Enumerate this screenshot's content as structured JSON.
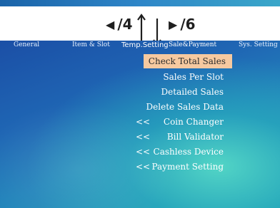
{
  "hints": {
    "left_label": "/4",
    "right_label": "/6",
    "left_icon": "triangle-left-icon",
    "right_icon": "triangle-right-icon",
    "updown_icon": "up-down-arrows-icon"
  },
  "tabs": [
    {
      "label": "General"
    },
    {
      "label": "Item & Slot"
    },
    {
      "label": "Temp.Setting"
    },
    {
      "label": "Sale&Payment",
      "active": true
    },
    {
      "label": "Sys. Setting"
    }
  ],
  "menu": {
    "items": [
      {
        "label": "Check Total Sales",
        "selected": true,
        "prefix": ""
      },
      {
        "label": "Sales Per Slot",
        "prefix": ""
      },
      {
        "label": "Detailed Sales",
        "prefix": ""
      },
      {
        "label": "Delete Sales Data",
        "prefix": ""
      },
      {
        "label": "Coin Changer",
        "prefix": "<<"
      },
      {
        "label": "Bill Validator",
        "prefix": "<<"
      },
      {
        "label": "Cashless Device",
        "prefix": "<<"
      },
      {
        "label": "Payment Setting",
        "prefix": "<<"
      }
    ]
  },
  "colors": {
    "selected_bg": "#f6c9a0",
    "screen_top": "#1b4fa6",
    "screen_glow": "#5ae1c8"
  }
}
